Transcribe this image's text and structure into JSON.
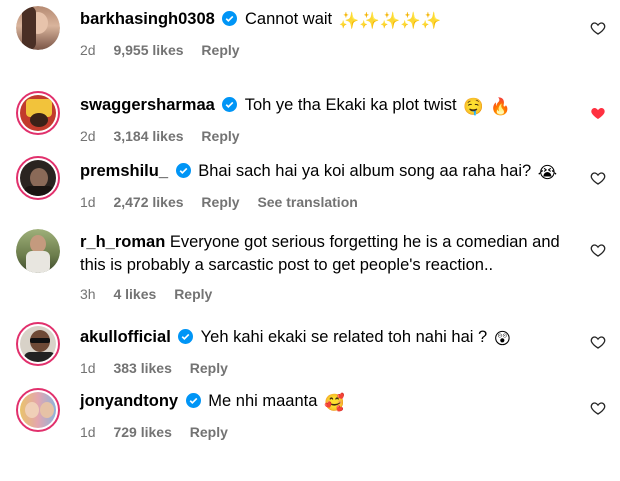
{
  "comments": [
    {
      "username": "barkhasingh0308",
      "text": "Cannot wait",
      "emoji": [
        "sparkles-emoji",
        "sparkles-emoji",
        "sparkles-emoji",
        "sparkles-emoji",
        "sparkles-emoji"
      ],
      "time": "2d",
      "likes": "9,955 likes",
      "reply": "Reply",
      "liked": false,
      "verified": true,
      "story_ring": false
    },
    {
      "username": "swaggersharmaa",
      "text": "Toh ye tha Ekaki ka plot twist",
      "emoji": [
        "drooling-face-emoji",
        "fire-emoji"
      ],
      "time": "2d",
      "likes": "3,184 likes",
      "reply": "Reply",
      "liked": true,
      "verified": true,
      "story_ring": true
    },
    {
      "username": "premshilu_",
      "text": "Bhai sach hai ya koi album song aa raha hai?",
      "emoji": [
        "crying-face-emoji"
      ],
      "time": "1d",
      "likes": "2,472 likes",
      "reply": "Reply",
      "translate": "See translation",
      "liked": false,
      "verified": true,
      "story_ring": true
    },
    {
      "username": "r_h_roman",
      "text": "Everyone got serious forgetting he is a comedian and this is probably a sarcastic post to get people's reaction..",
      "emoji": [],
      "time": "3h",
      "likes": "4 likes",
      "reply": "Reply",
      "liked": false,
      "verified": false,
      "story_ring": false
    },
    {
      "username": "akullofficial",
      "text": "Yeh kahi ekaki se related toh nahi hai ?",
      "emoji": [
        "face-with-open-mouth-emoji"
      ],
      "time": "1d",
      "likes": "383 likes",
      "reply": "Reply",
      "liked": false,
      "verified": true,
      "story_ring": true
    },
    {
      "username": "jonyandtony",
      "text": "Me nhi maanta",
      "emoji": [
        "smiling-hearts-emoji"
      ],
      "time": "1d",
      "likes": "729 likes",
      "reply": "Reply",
      "liked": false,
      "verified": true,
      "story_ring": true
    }
  ],
  "colors": {
    "liked_heart": "#ff3040",
    "verified": "#0095f6",
    "meta": "#737373"
  }
}
